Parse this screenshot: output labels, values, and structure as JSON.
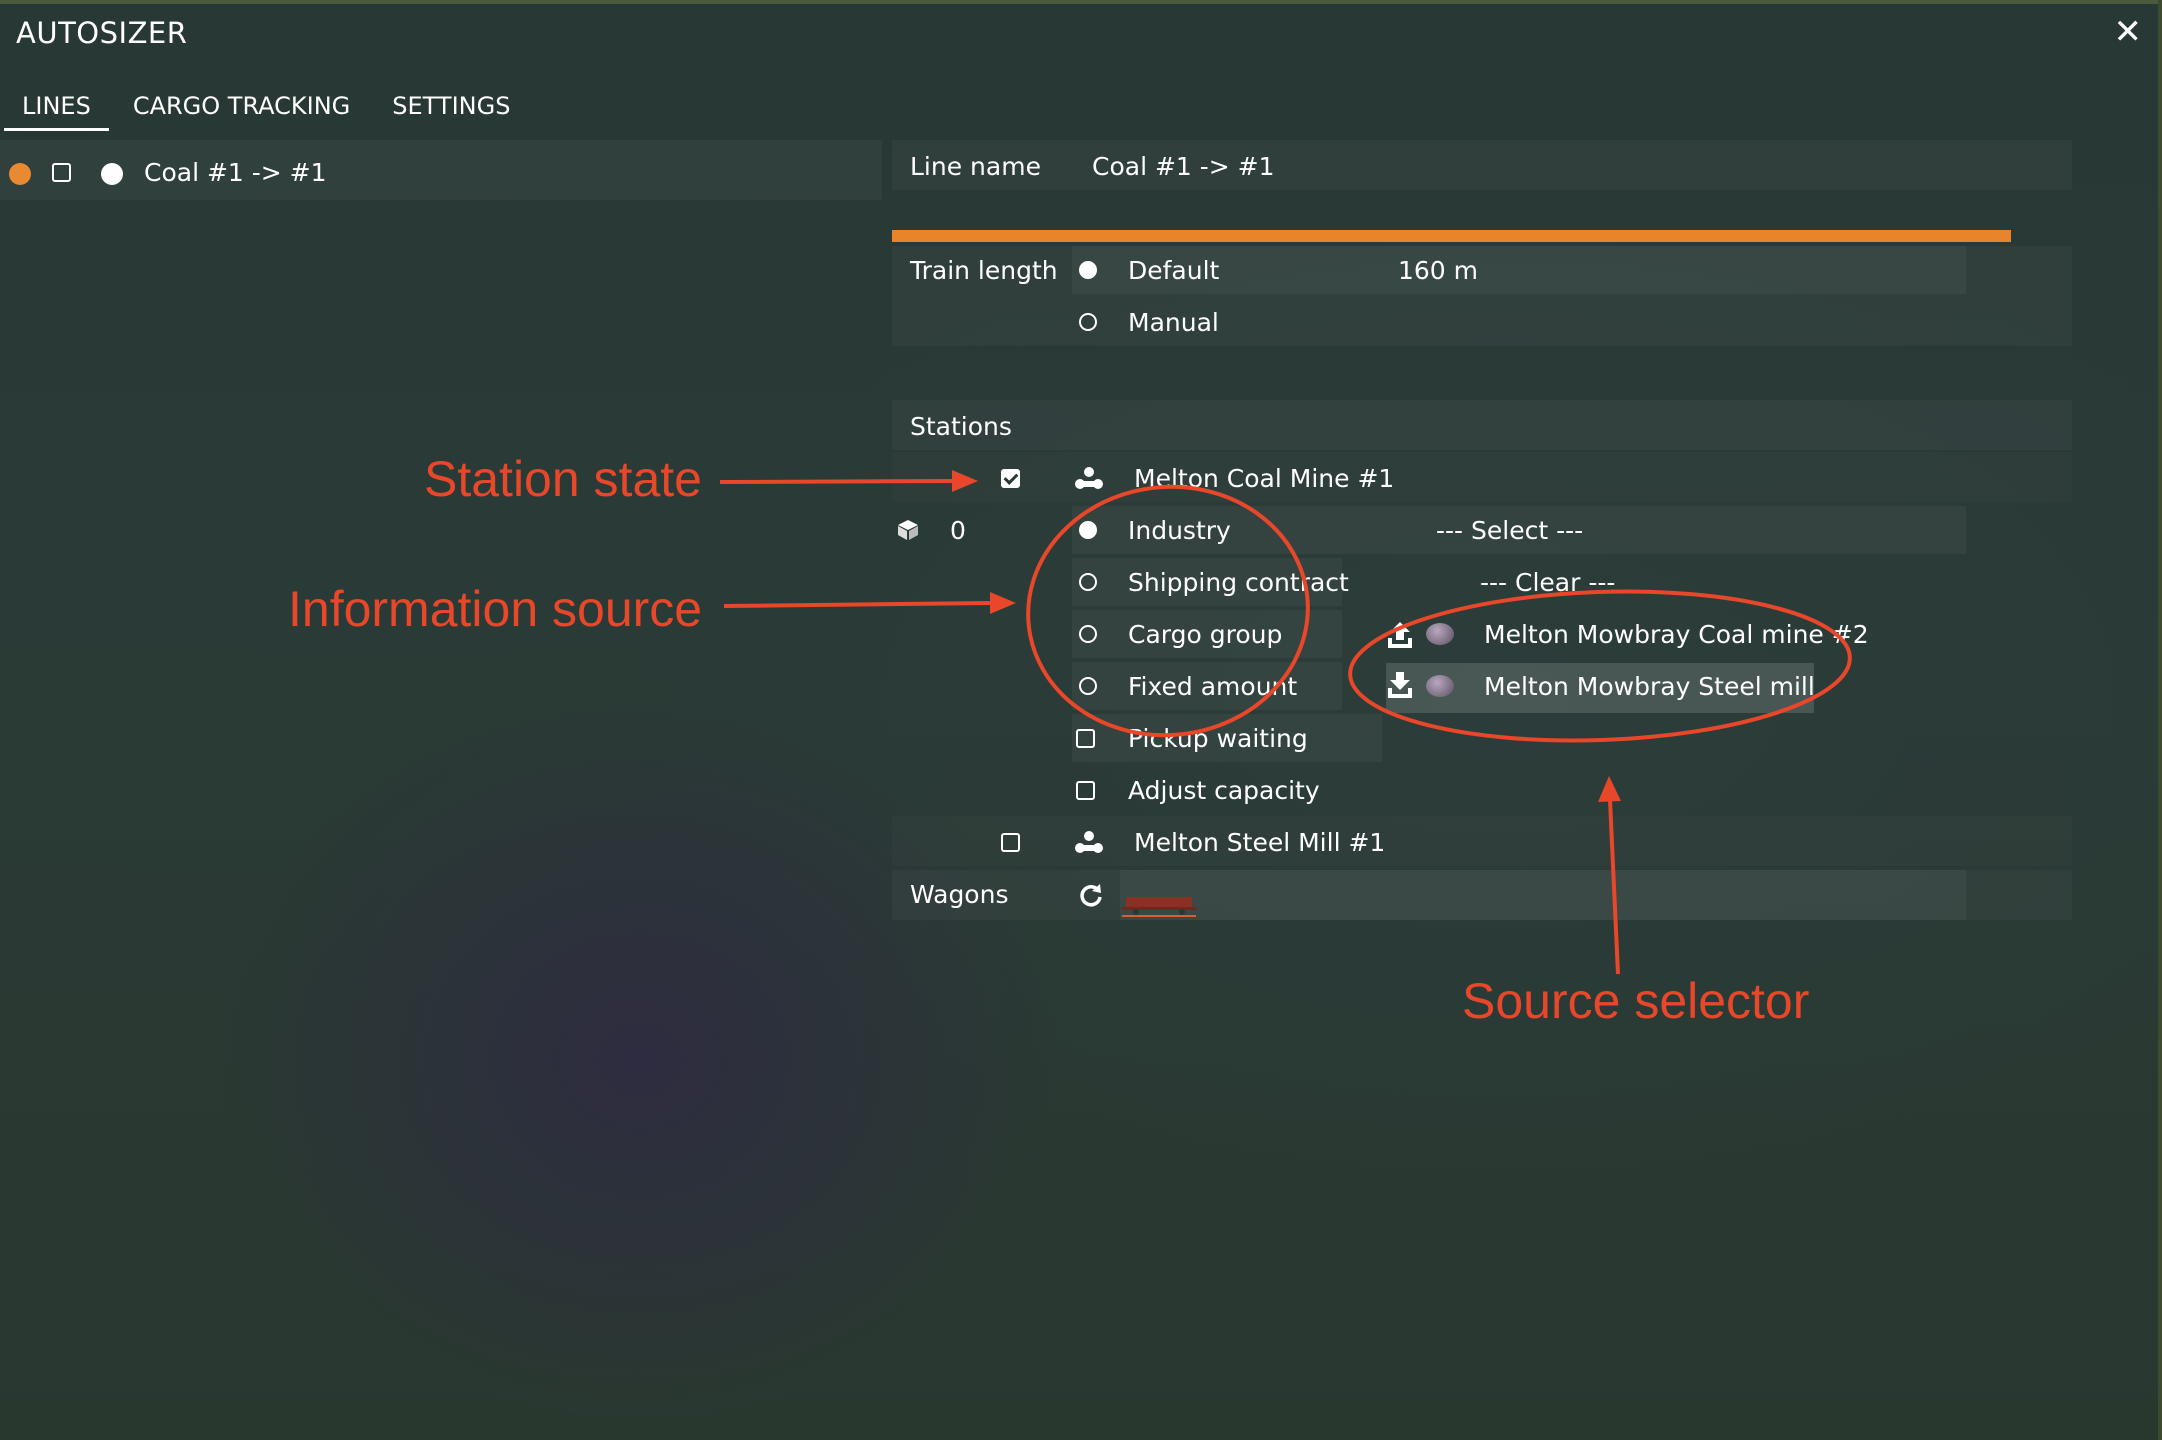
{
  "window": {
    "title": "AUTOSIZER",
    "close_symbol": "✕"
  },
  "tabs": [
    {
      "label": "LINES",
      "active": true
    },
    {
      "label": "CARGO TRACKING",
      "active": false
    },
    {
      "label": "SETTINGS",
      "active": false
    }
  ],
  "lines_list": [
    {
      "name": "Coal #1 -> #1",
      "color": "#e88a32",
      "checked": false,
      "selected": true
    }
  ],
  "line_details": {
    "line_name_label": "Line name",
    "line_name_value": "Coal #1 -> #1",
    "accent_color": "#e8842c",
    "train_length": {
      "label": "Train length",
      "options": [
        {
          "label": "Default",
          "selected": true,
          "value": "160 m"
        },
        {
          "label": "Manual",
          "selected": false
        }
      ]
    },
    "stations_label": "Stations",
    "stations": [
      {
        "name": "Melton Coal Mine #1",
        "enabled": true,
        "icon": "station-icon"
      },
      {
        "name": "Melton Steel Mill #1",
        "enabled": false,
        "icon": "station-icon"
      }
    ],
    "cargo_amount": "0",
    "information_source": [
      {
        "label": "Industry",
        "selected": true
      },
      {
        "label": "Shipping contract",
        "selected": false
      },
      {
        "label": "Cargo group",
        "selected": false
      },
      {
        "label": "Fixed amount",
        "selected": false
      }
    ],
    "options": [
      {
        "label": "Pickup waiting",
        "checked": false
      },
      {
        "label": "Adjust capacity",
        "checked": false
      }
    ],
    "source_selector": {
      "select_label": "--- Select ---",
      "clear_label": "--- Clear ---",
      "items": [
        {
          "direction": "upload-icon",
          "name": "Melton Mowbray Coal mine #2",
          "highlighted": false
        },
        {
          "direction": "download-icon",
          "name": "Melton Mowbray Steel mill",
          "highlighted": true
        }
      ]
    },
    "wagons_label": "Wagons"
  },
  "annotations": {
    "station_state": "Station state",
    "information_source": "Information source",
    "source_selector": "Source selector",
    "color": "#e8472a"
  }
}
